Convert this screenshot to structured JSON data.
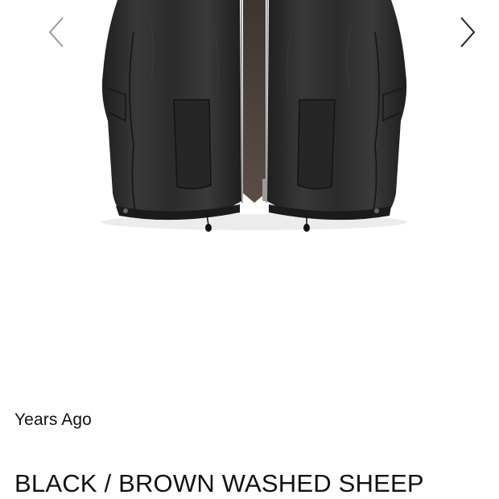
{
  "gallery": {
    "prev_icon": "chevron-left-icon",
    "next_icon": "chevron-right-icon",
    "image_subject": "black leather jacket"
  },
  "product": {
    "brand": "Years Ago",
    "title": "BLACK / BROWN WASHED SHEEP"
  },
  "colors": {
    "text": "#111111",
    "background": "#ffffff",
    "arrow_prev": "#9a9a9a",
    "arrow_next": "#222222",
    "leather": "#2a2a2a",
    "lining": "#4a3f3a"
  }
}
